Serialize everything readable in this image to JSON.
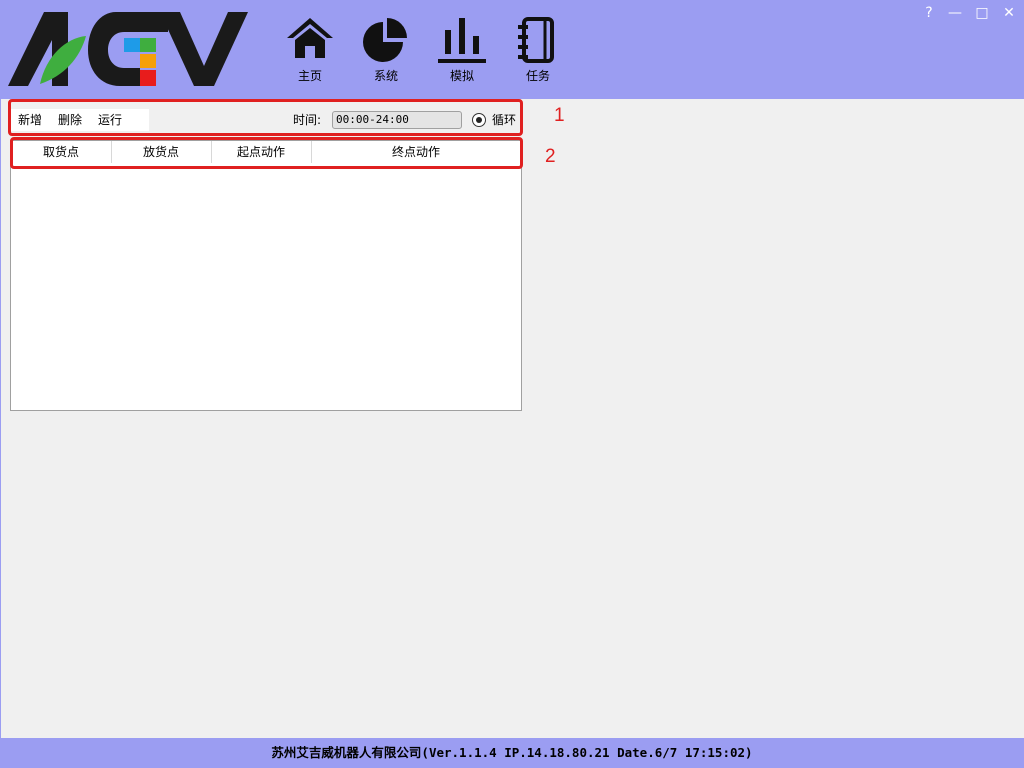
{
  "window_controls": {
    "help": "?",
    "minimize": "—",
    "maximize": "□",
    "close": "✕"
  },
  "logo": {
    "text": "AGV"
  },
  "nav": [
    {
      "label": "主页",
      "icon": "home-icon"
    },
    {
      "label": "系统",
      "icon": "pie-chart-icon"
    },
    {
      "label": "模拟",
      "icon": "bar-chart-icon"
    },
    {
      "label": "任务",
      "icon": "notebook-icon"
    }
  ],
  "toolbar": {
    "add_label": "新增",
    "delete_label": "删除",
    "run_label": "运行",
    "time_label": "时间:",
    "time_value": "00:00-24:00",
    "loop_label": "循环",
    "loop_checked": true
  },
  "table": {
    "columns": [
      "取货点",
      "放货点",
      "起点动作",
      "终点动作"
    ],
    "rows": []
  },
  "annotations": {
    "box1": "1",
    "box2": "2"
  },
  "footer": {
    "text": "苏州艾吉威机器人有限公司(Ver.1.1.4 IP.14.18.80.21 Date.6/7 17:15:02)"
  },
  "colors": {
    "header_bg": "#9b9df2",
    "annotation_red": "#e02020",
    "logo_green": "#3fae3f",
    "logo_blue": "#1e9be8",
    "logo_orange": "#f5a00a",
    "logo_red": "#e81c1c"
  }
}
